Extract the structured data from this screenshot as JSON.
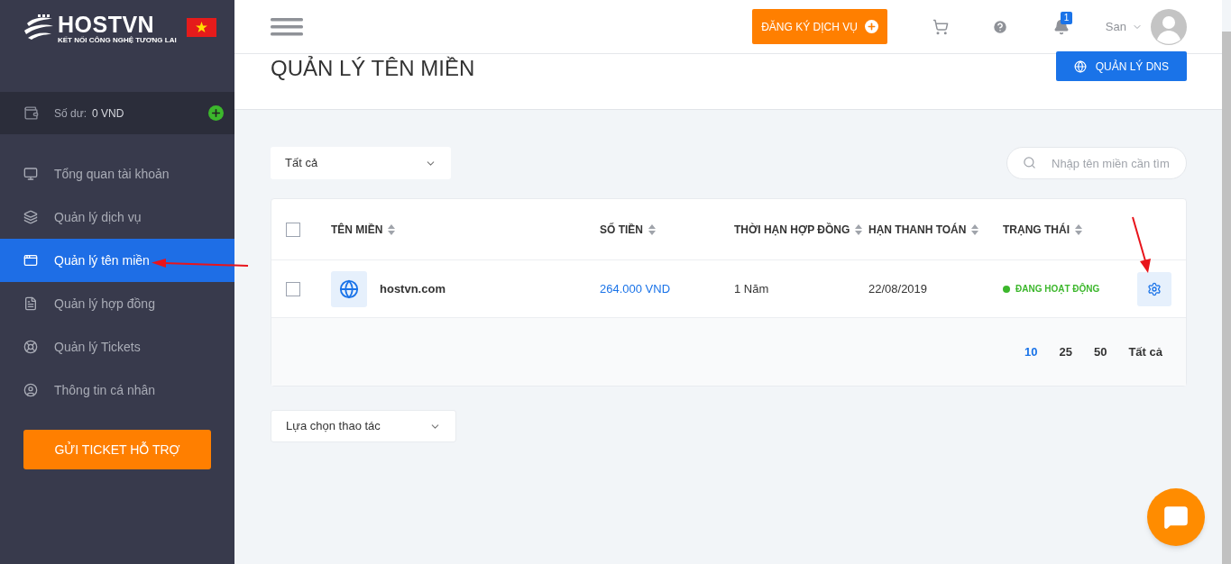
{
  "brand": {
    "name": "HOSTVN",
    "tagline": "KẾT NỐI CÔNG NGHỆ TƯƠNG LAI"
  },
  "balance": {
    "label": "Số dư:",
    "value": "0 VND"
  },
  "sidebar": {
    "items": [
      {
        "label": "Tổng quan tài khoản",
        "selected": false
      },
      {
        "label": "Quản lý dịch vụ",
        "selected": false
      },
      {
        "label": "Quản lý tên miền",
        "selected": true
      },
      {
        "label": "Quản lý hợp đồng",
        "selected": false
      },
      {
        "label": "Quản lý Tickets",
        "selected": false
      },
      {
        "label": "Thông tin cá nhân",
        "selected": false
      }
    ],
    "support_button": "GỬI TICKET HỖ TRỢ"
  },
  "header": {
    "register_button": "ĐĂNG KÝ DỊCH VỤ",
    "notification_count": "1",
    "user": "San"
  },
  "page": {
    "title": "QUẢN LÝ TÊN MIỀN",
    "dns_button": "QUẢN LÝ DNS"
  },
  "filter": {
    "value": "Tất cả"
  },
  "search": {
    "placeholder": "Nhập tên miền cần tìm"
  },
  "table": {
    "select_all": {
      "checked": false
    },
    "columns": [
      "TÊN MIỀN",
      "SỐ TIỀN",
      "THỜI HẠN HỢP ĐỒNG",
      "HẠN THANH TOÁN",
      "TRẠNG THÁI"
    ],
    "rows": [
      {
        "checked": false,
        "domain": "hostvn.com",
        "price": "264.000 VND",
        "term": "1 Năm",
        "due": "22/08/2019",
        "status": "ĐANG HOẠT ĐỘNG",
        "color": "#3cb72c"
      }
    ]
  },
  "page_sizes": [
    {
      "label": "10",
      "selected": true
    },
    {
      "label": "25",
      "selected": false
    },
    {
      "label": "50",
      "selected": false
    },
    {
      "label": "Tất cả",
      "selected": false
    }
  ],
  "bulk_action": {
    "value": "Lựa chọn thao tác"
  }
}
